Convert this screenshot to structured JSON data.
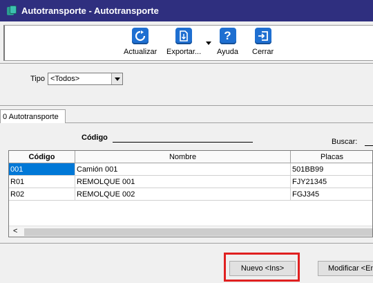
{
  "window": {
    "title": "Autotransporte - Autotransporte"
  },
  "toolbar": {
    "actualizar": "Actualizar",
    "exportar": "Exportar...",
    "ayuda": "Ayuda",
    "cerrar": "Cerrar"
  },
  "filter": {
    "tipo_label": "Tipo",
    "tipo_value": "<Todos>"
  },
  "tabs": [
    {
      "label": "0 Autotransporte"
    }
  ],
  "search": {
    "codigo_label": "Código",
    "buscar_label": "Buscar:"
  },
  "grid": {
    "columns": [
      "Código",
      "Nombre",
      "Placas"
    ],
    "rows": [
      {
        "codigo": "001",
        "nombre": "Camión 001",
        "placas": "501BB99"
      },
      {
        "codigo": "R01",
        "nombre": "REMOLQUE 001",
        "placas": "FJY21345"
      },
      {
        "codigo": "R02",
        "nombre": "REMOLQUE 002",
        "placas": "FGJ345"
      }
    ],
    "scroll_left_glyph": "<"
  },
  "buttons": {
    "nuevo": "Nuevo <Ins>",
    "modificar": "Modificar <Ent"
  },
  "colors": {
    "titlebar": "#2f2f7f",
    "selection": "#0078d7",
    "highlight": "#e02020",
    "icon_blue": "#1e6fd1"
  },
  "icons": {
    "actualizar": "refresh-icon",
    "exportar": "export-icon",
    "ayuda": "help-icon",
    "cerrar": "exit-icon"
  }
}
